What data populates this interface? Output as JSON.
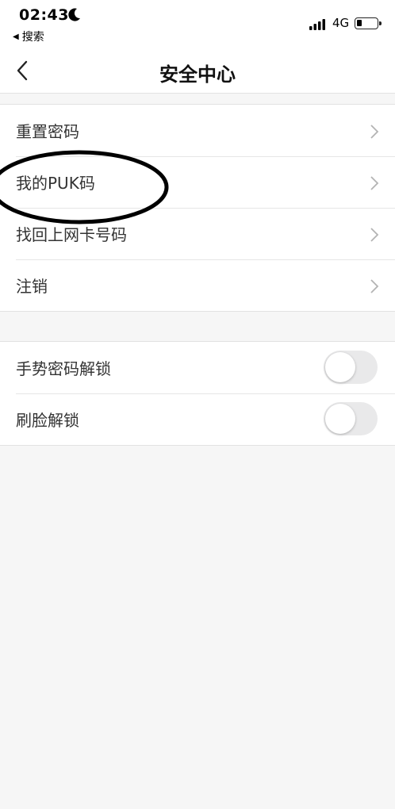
{
  "status_bar": {
    "time": "02:43",
    "back_app_label": "搜索",
    "network": "4G",
    "battery_level": 0.25
  },
  "nav": {
    "title": "安全中心"
  },
  "menu_group": {
    "items": [
      {
        "label": "重置密码"
      },
      {
        "label": "我的PUK码"
      },
      {
        "label": "找回上网卡号码"
      },
      {
        "label": "注销"
      }
    ]
  },
  "toggle_group": {
    "items": [
      {
        "label": "手势密码解锁",
        "enabled": false
      },
      {
        "label": "刷脸解锁",
        "enabled": false
      }
    ]
  },
  "colors": {
    "background": "#f6f6f6",
    "toggle_off": "#e9e9ea",
    "annotation": "#000000"
  }
}
